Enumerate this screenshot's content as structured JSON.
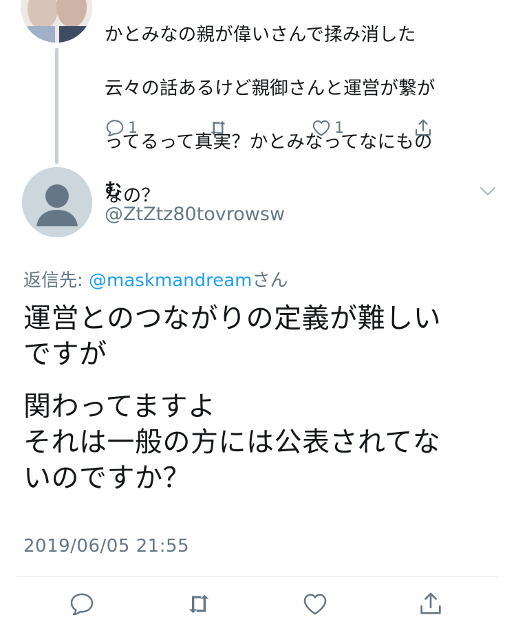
{
  "parent_tweet": {
    "text_lines": [
      "かとみなの親が偉いさんで揉み消した",
      "云々の話あるけど親御さんと運営が繋が",
      "ってるって真実？かとみなってなにもの",
      "なの？"
    ],
    "reply_count": "1",
    "like_count": "1",
    "icons": [
      "reply-icon",
      "retweet-icon",
      "like-icon",
      "share-icon"
    ]
  },
  "tweet": {
    "display_name": "む",
    "handle": "@ZtZtz80tovrowsw",
    "reply_prefix": "返信先: ",
    "reply_mention": "@maskmandream",
    "reply_suffix": "さん",
    "paragraphs": [
      "運営とのつながりの定義が難しい\nですが",
      "関わってますよ\nそれは一般の方には公表されてな\nいのですか？"
    ],
    "timestamp": "2019/06/05 21:55"
  },
  "actions": [
    "reply-icon",
    "retweet-icon",
    "like-icon",
    "share-icon"
  ],
  "colors": {
    "accent": "#1da1f2",
    "secondary_text": "#657786",
    "thread_line": "#c4cfd6",
    "divider": "#e1e8ed"
  }
}
